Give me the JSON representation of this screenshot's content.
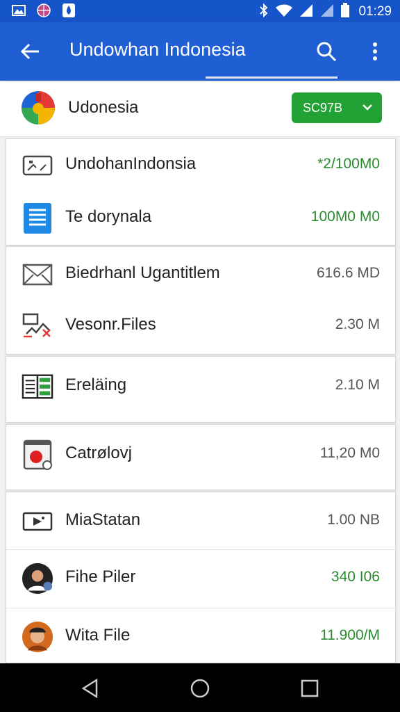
{
  "status_bar": {
    "time": "01:29",
    "icons": [
      "image-notification-icon",
      "globe-icon",
      "water-drop-icon",
      "bluetooth-icon",
      "wifi-icon",
      "signal-icon",
      "signal-icon",
      "battery-icon"
    ]
  },
  "appbar": {
    "title": "Undowhan Indonesia",
    "back_icon": "arrow-back-icon",
    "search_icon": "search-icon",
    "more_icon": "more-vert-icon",
    "bg_color": "#1f5fd3"
  },
  "account": {
    "name": "Udonesia",
    "chip_label": "SC97B",
    "chip_color": "#22a235"
  },
  "sections": [
    {
      "rows": [
        {
          "icon": "image-icon",
          "label": "UndohanIndonsia",
          "size": "*2/100M0",
          "size_color": "green"
        },
        {
          "icon": "document-icon",
          "label": "Te dorynala",
          "size": "100M0 M0",
          "size_color": "green"
        }
      ]
    },
    {
      "rows": [
        {
          "icon": "mail-icon",
          "label": "Biedrhanl Ugantitlem",
          "size": "616.6 MD",
          "size_color": "gray"
        },
        {
          "icon": "files-icon",
          "label": "Vesonr.Files",
          "size": "2.30 M",
          "size_color": "gray"
        }
      ]
    },
    {
      "rows": [
        {
          "icon": "spreadsheet-icon",
          "label": "Ereläing",
          "size": "2.10 M",
          "size_color": "gray"
        }
      ]
    },
    {
      "rows": [
        {
          "icon": "record-icon",
          "label": "Catrølovj",
          "size": "11,20 M0",
          "size_color": "gray"
        }
      ]
    },
    {
      "rows": [
        {
          "icon": "media-icon",
          "label": "MiaStatan",
          "size": "1.00 NB",
          "size_color": "gray"
        },
        {
          "icon": "avatar-icon",
          "label": "Fihe Piler",
          "size": "340 I06",
          "size_color": "green"
        },
        {
          "icon": "avatar-icon",
          "label": "Wita File",
          "size": "11.900/M",
          "size_color": "green"
        }
      ]
    }
  ],
  "navbar": {
    "back_icon": "nav-back-icon",
    "home_icon": "nav-home-icon",
    "recents_icon": "nav-recents-icon"
  }
}
